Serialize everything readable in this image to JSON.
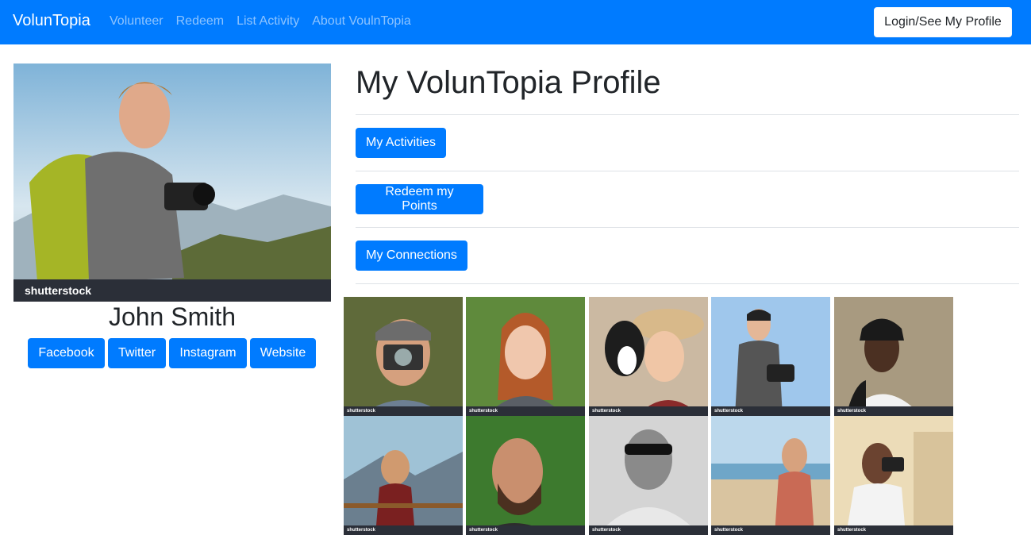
{
  "navbar": {
    "brand": "VolunTopia",
    "links": [
      "Volunteer",
      "Redeem",
      "List Activity",
      "About VoulnTopia"
    ],
    "login_label": "Login/See My Profile"
  },
  "profile": {
    "name": "John Smith",
    "watermark": "shutterstock",
    "social": [
      "Facebook",
      "Twitter",
      "Instagram",
      "Website"
    ]
  },
  "main": {
    "title": "My VolunTopia Profile",
    "actions": [
      "My Activities",
      "Redeem my Points",
      "My Connections"
    ]
  },
  "gallery": {
    "watermark": "shutterstock",
    "tiles": [
      "photographer-man",
      "redhead-woman",
      "woman-with-dog",
      "hiker-woman",
      "man-with-dreadlocks",
      "man-on-bridge",
      "bearded-man",
      "man-with-sunglasses",
      "woman-on-beach",
      "woman-with-camera"
    ]
  },
  "colors": {
    "primary": "#007bff",
    "navbar_link": "rgba(255,255,255,0.55)"
  }
}
